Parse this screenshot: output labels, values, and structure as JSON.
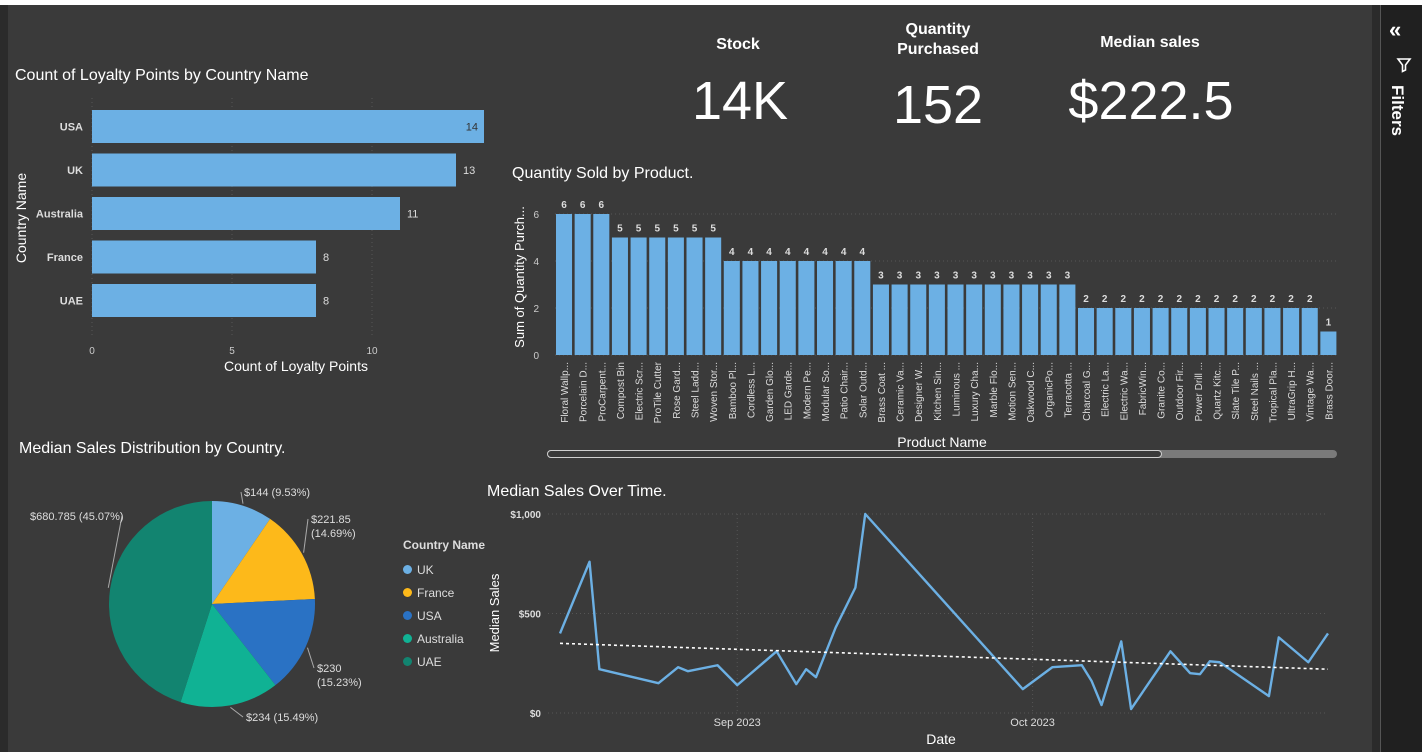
{
  "kpis": {
    "stock": {
      "label": "Stock",
      "value": "14K"
    },
    "quantity": {
      "label_line1": "Quantity",
      "label_line2": "Purchased",
      "value": "152"
    },
    "median": {
      "label": "Median sales",
      "value": "$222.5"
    }
  },
  "filters": {
    "label": "Filters",
    "collapse_icon": "double-chevron-left-icon",
    "filter_icon": "funnel-icon"
  },
  "colors": {
    "bar": "#6cb0e4",
    "pie": [
      "#6cb0e4",
      "#fdb91a",
      "#2a72c4",
      "#10b294",
      "#128470"
    ]
  },
  "chart_data": [
    {
      "type": "bar",
      "orientation": "horizontal",
      "title": "Count of Loyalty Points by Country Name",
      "categories": [
        "USA",
        "UK",
        "Australia",
        "France",
        "UAE"
      ],
      "values": [
        14,
        13,
        11,
        8,
        8
      ],
      "data_labels": [
        "14",
        "13",
        "11",
        "8",
        "8"
      ],
      "xlabel": "Count of Loyalty Points",
      "ylabel": "Country Name",
      "xlim": [
        0,
        14
      ],
      "xticks": [
        0,
        5,
        10
      ],
      "xtick_labels": [
        "0",
        "5",
        "10"
      ],
      "grid": true
    },
    {
      "type": "bar",
      "title": "Quantity Sold by Product.",
      "xlabel": "Product Name",
      "ylabel": "Sum of Quantity Purch...",
      "ylim": [
        0,
        6
      ],
      "yticks": [
        0,
        2,
        4,
        6
      ],
      "ytick_labels": [
        "0",
        "2",
        "4",
        "6"
      ],
      "categories": [
        "Floral Wallp...",
        "Porcelain D...",
        "ProCarpent...",
        "Compost Bin",
        "Electric Scr...",
        "ProTile Cutter",
        "Rose Gard...",
        "Steel Ladd...",
        "Woven Stor...",
        "Bamboo Pl...",
        "Cordless L...",
        "Garden Glo...",
        "LED Garde...",
        "Modern Pe...",
        "Modular So...",
        "Patio Chair...",
        "Solar Outd...",
        "Brass Coat ...",
        "Ceramic Va...",
        "Designer W...",
        "Kitchen Sin...",
        "Luminous ...",
        "Luxury Cha...",
        "Marble Flo...",
        "Motion Sen...",
        "Oakwood C...",
        "OrganicPo...",
        "Terracotta ...",
        "Charcoal G...",
        "Electric La...",
        "Electric Wa...",
        "FabricWin...",
        "Granite Co...",
        "Outdoor Fir...",
        "Power Drill ...",
        "Quartz Kitc...",
        "Slate Tile P...",
        "Steel Nails ...",
        "Tropical Pla...",
        "UltraGrip H...",
        "Vintage Wa...",
        "Brass Door..."
      ],
      "values": [
        6,
        6,
        6,
        5,
        5,
        5,
        5,
        5,
        5,
        4,
        4,
        4,
        4,
        4,
        4,
        4,
        4,
        3,
        3,
        3,
        3,
        3,
        3,
        3,
        3,
        3,
        3,
        3,
        2,
        2,
        2,
        2,
        2,
        2,
        2,
        2,
        2,
        2,
        2,
        2,
        2,
        1
      ],
      "data_labels": [
        "6",
        "6",
        "6",
        "5",
        "5",
        "5",
        "5",
        "5",
        "5",
        "4",
        "4",
        "4",
        "4",
        "4",
        "4",
        "4",
        "4",
        "3",
        "3",
        "3",
        "3",
        "3",
        "3",
        "3",
        "3",
        "3",
        "3",
        "3",
        "2",
        "2",
        "2",
        "2",
        "2",
        "2",
        "2",
        "2",
        "2",
        "2",
        "2",
        "2",
        "2",
        "1"
      ],
      "grid": true
    },
    {
      "type": "pie",
      "title": "Median Sales Distribution by Country.",
      "legend_title": "Country Name",
      "legend_position": "right",
      "slices": [
        {
          "name": "UK",
          "value": 144,
          "pct": 9.53,
          "label_line1": "$144 (9.53%)",
          "label_line2": ""
        },
        {
          "name": "France",
          "value": 221.85,
          "pct": 14.69,
          "label_line1": "$221.85",
          "label_line2": "(14.69%)"
        },
        {
          "name": "USA",
          "value": 230,
          "pct": 15.23,
          "label_line1": "$230",
          "label_line2": "(15.23%)"
        },
        {
          "name": "Australia",
          "value": 234,
          "pct": 15.49,
          "label_line1": "$234 (15.49%)",
          "label_line2": ""
        },
        {
          "name": "UAE",
          "value": 680.785,
          "pct": 45.07,
          "label_line1": "$680.785 (45.07%)",
          "label_line2": ""
        }
      ]
    },
    {
      "type": "line",
      "title": "Median Sales Over Time.",
      "xlabel": "Date",
      "ylabel": "Median Sales",
      "ylim": [
        0,
        1000
      ],
      "yticks": [
        0,
        500,
        1000
      ],
      "ytick_labels": [
        "$0",
        "$500",
        "$1,000"
      ],
      "xtick_labels": [
        "Sep 2023",
        "Oct 2023"
      ],
      "x_range": [
        "2023-08-14",
        "2023-10-31"
      ],
      "xticks": [
        "2023-09-01",
        "2023-10-01"
      ],
      "points": [
        [
          "2023-08-14",
          400
        ],
        [
          "2023-08-17",
          760
        ],
        [
          "2023-08-18",
          220
        ],
        [
          "2023-08-24",
          150
        ],
        [
          "2023-08-26",
          230
        ],
        [
          "2023-08-27",
          210
        ],
        [
          "2023-08-30",
          240
        ],
        [
          "2023-09-01",
          140
        ],
        [
          "2023-09-05",
          310
        ],
        [
          "2023-09-07",
          145
        ],
        [
          "2023-09-08",
          220
        ],
        [
          "2023-09-09",
          180
        ],
        [
          "2023-09-11",
          430
        ],
        [
          "2023-09-13",
          630
        ],
        [
          "2023-09-14",
          1000
        ],
        [
          "2023-09-30",
          120
        ],
        [
          "2023-10-03",
          230
        ],
        [
          "2023-10-06",
          240
        ],
        [
          "2023-10-07",
          160
        ],
        [
          "2023-10-08",
          40
        ],
        [
          "2023-10-10",
          360
        ],
        [
          "2023-10-11",
          20
        ],
        [
          "2023-10-15",
          310
        ],
        [
          "2023-10-17",
          200
        ],
        [
          "2023-10-18",
          195
        ],
        [
          "2023-10-19",
          260
        ],
        [
          "2023-10-20",
          255
        ],
        [
          "2023-10-25",
          85
        ],
        [
          "2023-10-26",
          380
        ],
        [
          "2023-10-29",
          255
        ],
        [
          "2023-10-31",
          400
        ]
      ],
      "trend_line": {
        "style": "dashed",
        "start": [
          "2023-08-14",
          350
        ],
        "end": [
          "2023-10-31",
          220
        ]
      },
      "grid": true
    }
  ]
}
